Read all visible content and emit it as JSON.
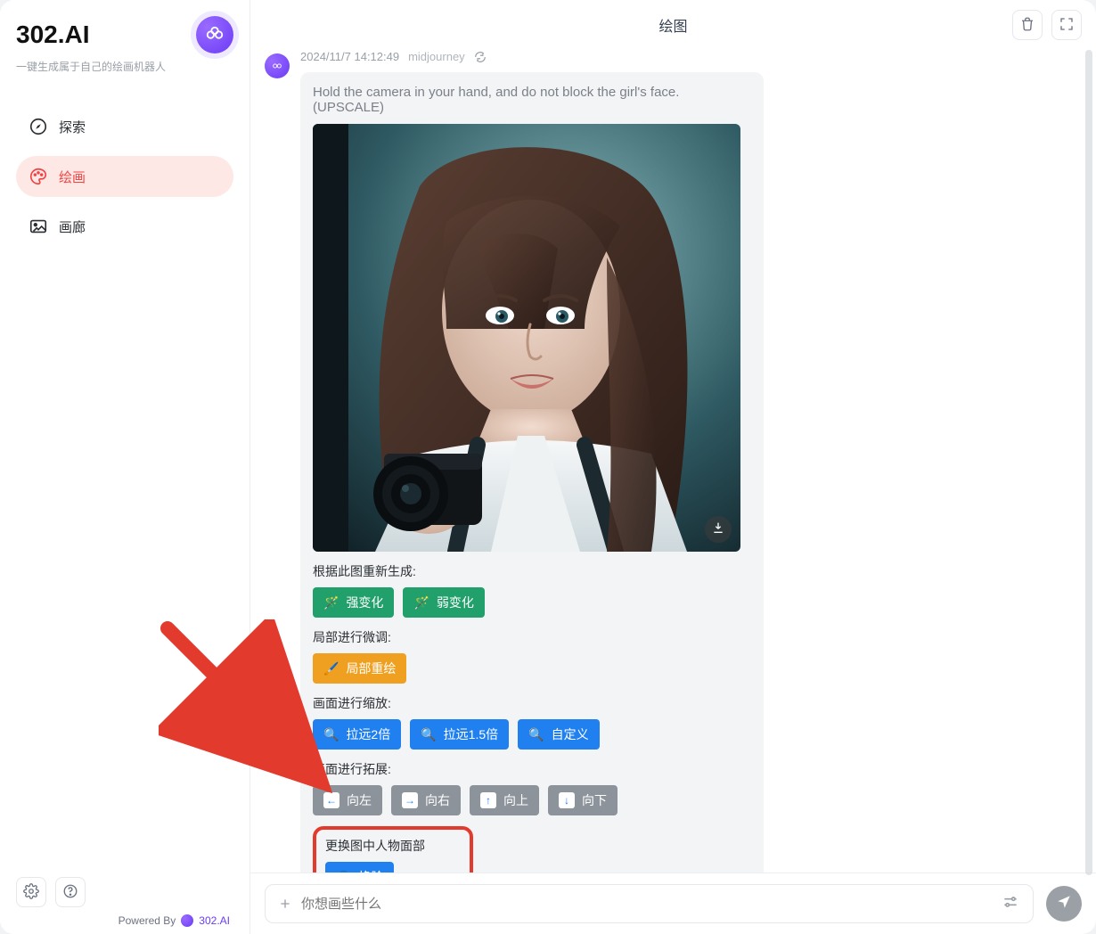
{
  "sidebar": {
    "title": "302.AI",
    "subtitle": "一键生成属于自己的绘画机器人",
    "nav": {
      "explore": "探索",
      "paint": "绘画",
      "gallery": "画廊"
    },
    "powered_by": "Powered By",
    "powered_brand": "302.AI"
  },
  "header": {
    "title": "绘图"
  },
  "message": {
    "timestamp": "2024/11/7 14:12:49",
    "model": "midjourney",
    "prompt": "Hold the camera in your hand, and do not block the girl's face. (UPSCALE)",
    "sections": {
      "regenerate_label": "根据此图重新生成:",
      "strong_variation": "强变化",
      "weak_variation": "弱变化",
      "local_tune_label": "局部进行微调:",
      "local_repaint": "局部重绘",
      "zoom_label": "画面进行缩放:",
      "zoom_2x": "拉远2倍",
      "zoom_1_5x": "拉远1.5倍",
      "zoom_custom": "自定义",
      "expand_label": "画面进行拓展:",
      "left": "向左",
      "right": "向右",
      "up": "向上",
      "down": "向下",
      "face_swap_label": "更换图中人物面部",
      "face_swap_btn": "换脸"
    }
  },
  "chat_input": {
    "placeholder": "你想画些什么"
  }
}
